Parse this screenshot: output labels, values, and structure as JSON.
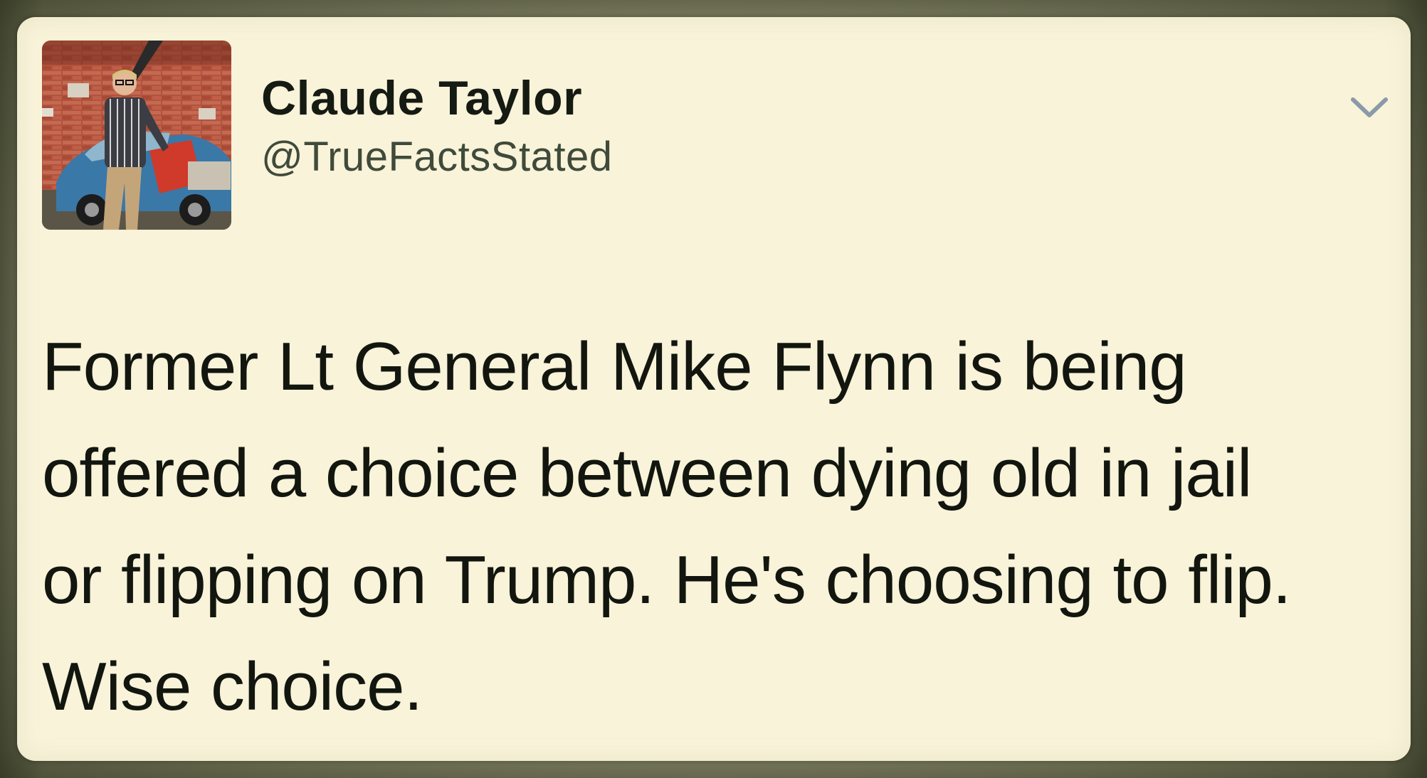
{
  "tweet": {
    "author": {
      "display_name": "Claude Taylor",
      "handle": "@TrueFactsStated",
      "avatar_icon": "profile-photo"
    },
    "menu_icon": "chevron-down-icon",
    "text_lines": [
      "Former Lt General Mike Flynn is being",
      "offered a choice between dying old in jail",
      "or flipping on Trump. He's choosing to flip.",
      "Wise choice."
    ]
  },
  "colors": {
    "card_background": "#f8f3d9",
    "text_primary": "#12160f",
    "text_secondary": "#3f4a3a",
    "frame": "#6b6d52",
    "chevron": "#8a9aa8"
  }
}
